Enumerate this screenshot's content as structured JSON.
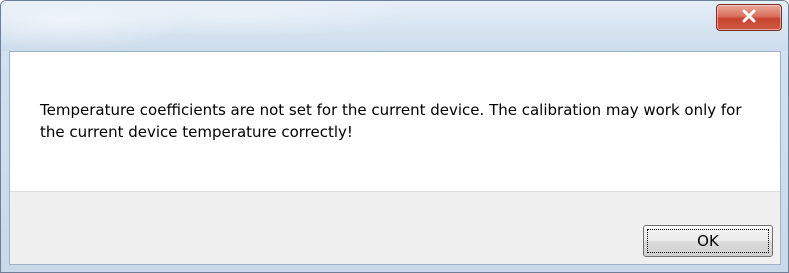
{
  "dialog": {
    "message": "Temperature coefficients are not set for the current device. The calibration may work only for the current device temperature correctly!",
    "ok_label": "OK"
  },
  "titlebar": {
    "close_icon": "close-icon"
  },
  "colors": {
    "close_button": "#c74330",
    "titlebar": "#d9e6f3",
    "button_area": "#f0f0f0"
  }
}
